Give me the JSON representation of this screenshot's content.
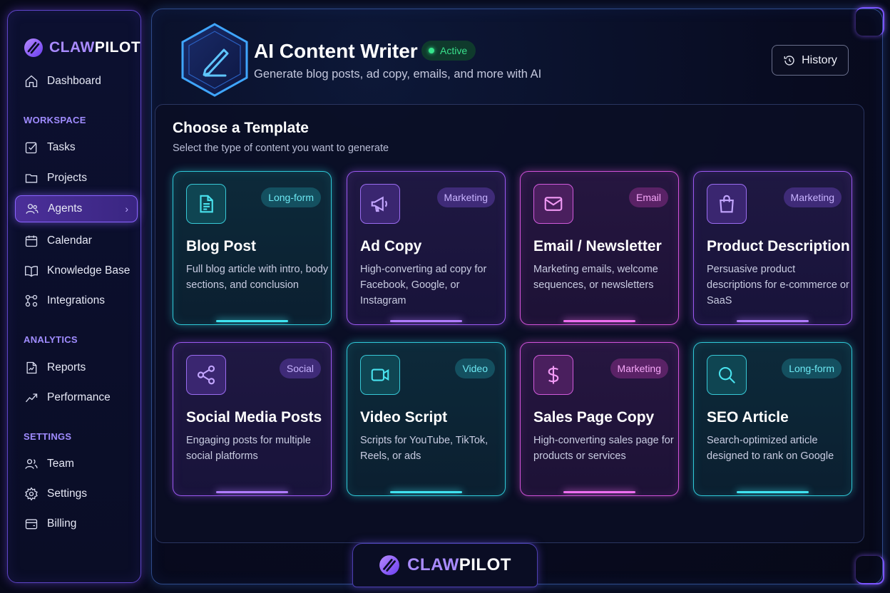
{
  "brand": {
    "name_part1": "CLAW",
    "name_part2": "PILOT"
  },
  "sidebar": {
    "dashboard": "Dashboard",
    "workspace_label": "WORKSPACE",
    "workspace": [
      "Tasks",
      "Projects",
      "Agents",
      "Calendar",
      "Knowledge Base",
      "Integrations"
    ],
    "analytics_label": "ANALYTICS",
    "analytics": [
      "Reports",
      "Performance"
    ],
    "settings_label": "SETTINGS",
    "settings": [
      "Team",
      "Settings",
      "Billing"
    ],
    "active_item": "Agents"
  },
  "header": {
    "title": "AI Content Writer",
    "status": "Active",
    "subtitle": "Generate blog posts, ad copy, emails, and more with AI",
    "history_button": "History"
  },
  "templates": {
    "title": "Choose a Template",
    "subtitle": "Select the type of content you want to generate",
    "cards": [
      {
        "title": "Blog Post",
        "tag": "Long-form",
        "desc": "Full blog article with intro, body sections, and conclusion",
        "icon": "document-icon",
        "theme": "teal"
      },
      {
        "title": "Ad Copy",
        "tag": "Marketing",
        "desc": "High-converting ad copy for Facebook, Google, or Instagram",
        "icon": "megaphone-icon",
        "theme": "purple"
      },
      {
        "title": "Email / Newsletter",
        "tag": "Email",
        "desc": "Marketing emails, welcome sequences, or newsletters",
        "icon": "mail-icon",
        "theme": "pink"
      },
      {
        "title": "Product Description",
        "tag": "Marketing",
        "desc": "Persuasive product descriptions for e-commerce or SaaS",
        "icon": "shopping-bag-icon",
        "theme": "purple"
      },
      {
        "title": "Social Media Posts",
        "tag": "Social",
        "desc": "Engaging posts for multiple social platforms",
        "icon": "share-icon",
        "theme": "purple"
      },
      {
        "title": "Video Script",
        "tag": "Video",
        "desc": "Scripts for YouTube, TikTok, Reels, or ads",
        "icon": "video-camera-icon",
        "theme": "teal"
      },
      {
        "title": "Sales Page Copy",
        "tag": "Marketing",
        "desc": "High-converting sales page for products or services",
        "icon": "dollar-icon",
        "theme": "pink"
      },
      {
        "title": "SEO Article",
        "tag": "Long-form",
        "desc": "Search-optimized article designed to rank on Google",
        "icon": "search-icon",
        "theme": "teal"
      }
    ]
  },
  "colors": {
    "accent_purple": "#8a63ff",
    "accent_teal": "#2fc9d8",
    "accent_pink": "#d152d9",
    "status_green": "#36e58c"
  }
}
